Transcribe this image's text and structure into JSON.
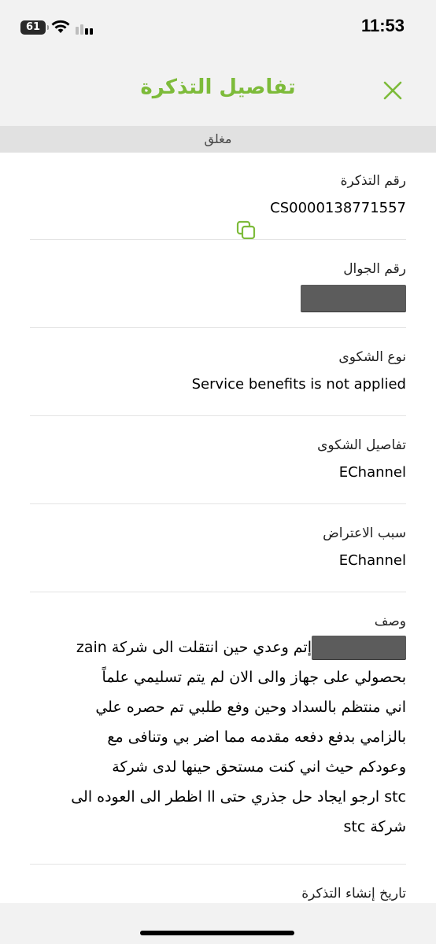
{
  "status_bar": {
    "time": "11:53",
    "battery": "61",
    "icons": [
      "battery-icon",
      "wifi-icon",
      "cellular-signal-icon"
    ]
  },
  "header": {
    "title": "تفاصيل التذكرة",
    "close_icon": "close-icon",
    "accent_color": "#7dbb3a"
  },
  "ticket_status": "مغلق",
  "fields": {
    "ticket_number": {
      "label": "رقم التذكرة",
      "value": "CS0000138771557",
      "copy_icon": "copy-icon"
    },
    "mobile_number": {
      "label": "رقم الجوال"
    },
    "complaint_type": {
      "label": "نوع الشكوى",
      "value": "Service benefits is not applied"
    },
    "complaint_details": {
      "label": "تفاصيل الشكوى",
      "value": "EChannel"
    },
    "objection_reason": {
      "label": "سبب الاعتراض",
      "value": "EChannel"
    },
    "description": {
      "label": "وصف",
      "lines": [
        "إتم وعدي حين انتقلت الى شركة zain",
        "بحصولي على جهاز والى الان لم يتم تسليمي علماً",
        "اني منتظم بالسداد وحين وفع طلبي تم حصره علي",
        "بالزامي بدفع دفعه مقدمه مما اضر بي وتنافى مع",
        "وعودكم حيث اني كنت مستحق حينها لدى شركة",
        "stc ارجو ايجاد حل جذري حتى اا اظطر الى العوده الى",
        "شركة stc"
      ]
    },
    "creation_date": {
      "label": "تاريخ إنشاء التذكرة"
    }
  }
}
